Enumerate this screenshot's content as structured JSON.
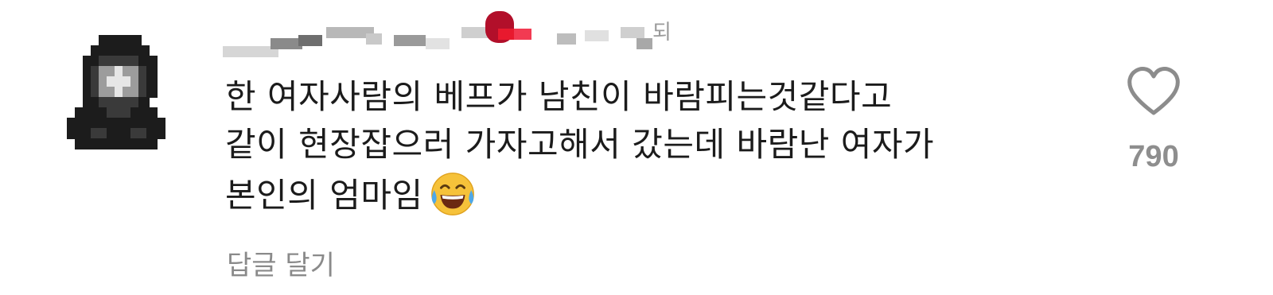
{
  "comment": {
    "username_suffix": "되",
    "text_lines": [
      "한 여자사람의 베프가 남친이 바람피는것같다고",
      "같이 현장잡으러 가자고해서 갔는데 바람난 여자가",
      "본인의 엄마임"
    ],
    "emoji": "face-with-tears-of-joy",
    "reply_label": "답글 달기",
    "like_count": "790",
    "like_icon": "heart-outline-icon"
  },
  "colors": {
    "text": "#1b1b1b",
    "muted": "#8a8a8a",
    "like_count": "#8e8e8e",
    "heart_stroke": "#8c8c8c"
  }
}
